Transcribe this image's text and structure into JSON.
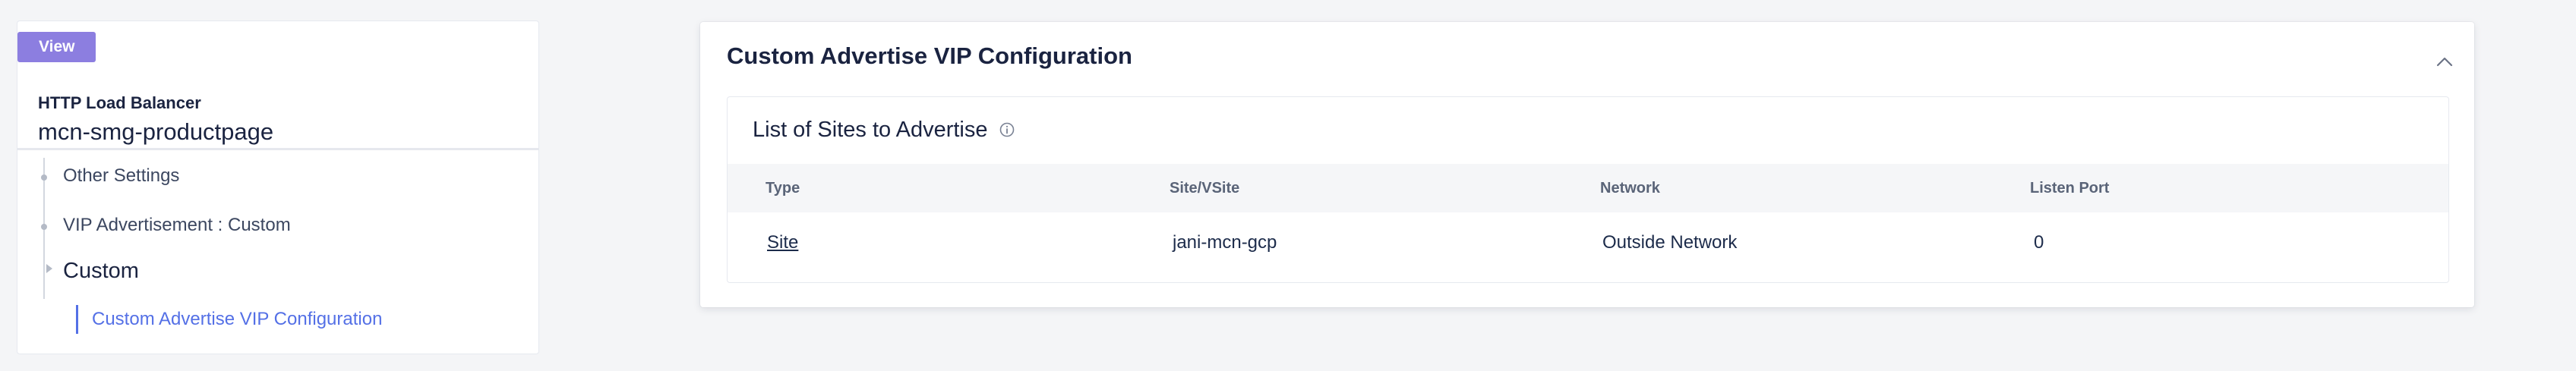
{
  "left_panel": {
    "badge": "View",
    "object_type": "HTTP Load Balancer",
    "object_name": "mcn-smg-productpage",
    "nav": {
      "other_settings": "Other Settings",
      "vip_advertisement": "VIP Advertisement : Custom",
      "custom_section": "Custom",
      "custom_vip_config": "Custom Advertise VIP Configuration"
    }
  },
  "card": {
    "title": "Custom Advertise VIP Configuration",
    "collapse_icon": "chevron-up-icon",
    "sites": {
      "title": "List of Sites to Advertise",
      "info_icon": "info-icon",
      "columns": [
        "Type",
        "Site/VSite",
        "Network",
        "Listen Port"
      ],
      "rows": [
        [
          "Site",
          "jani-mcn-gcp",
          "Outside Network",
          "0"
        ]
      ]
    }
  },
  "colors": {
    "badge": "#8c7ee0",
    "accent": "#5470e6",
    "background": "#f4f5f7",
    "text": "#1a2340"
  }
}
